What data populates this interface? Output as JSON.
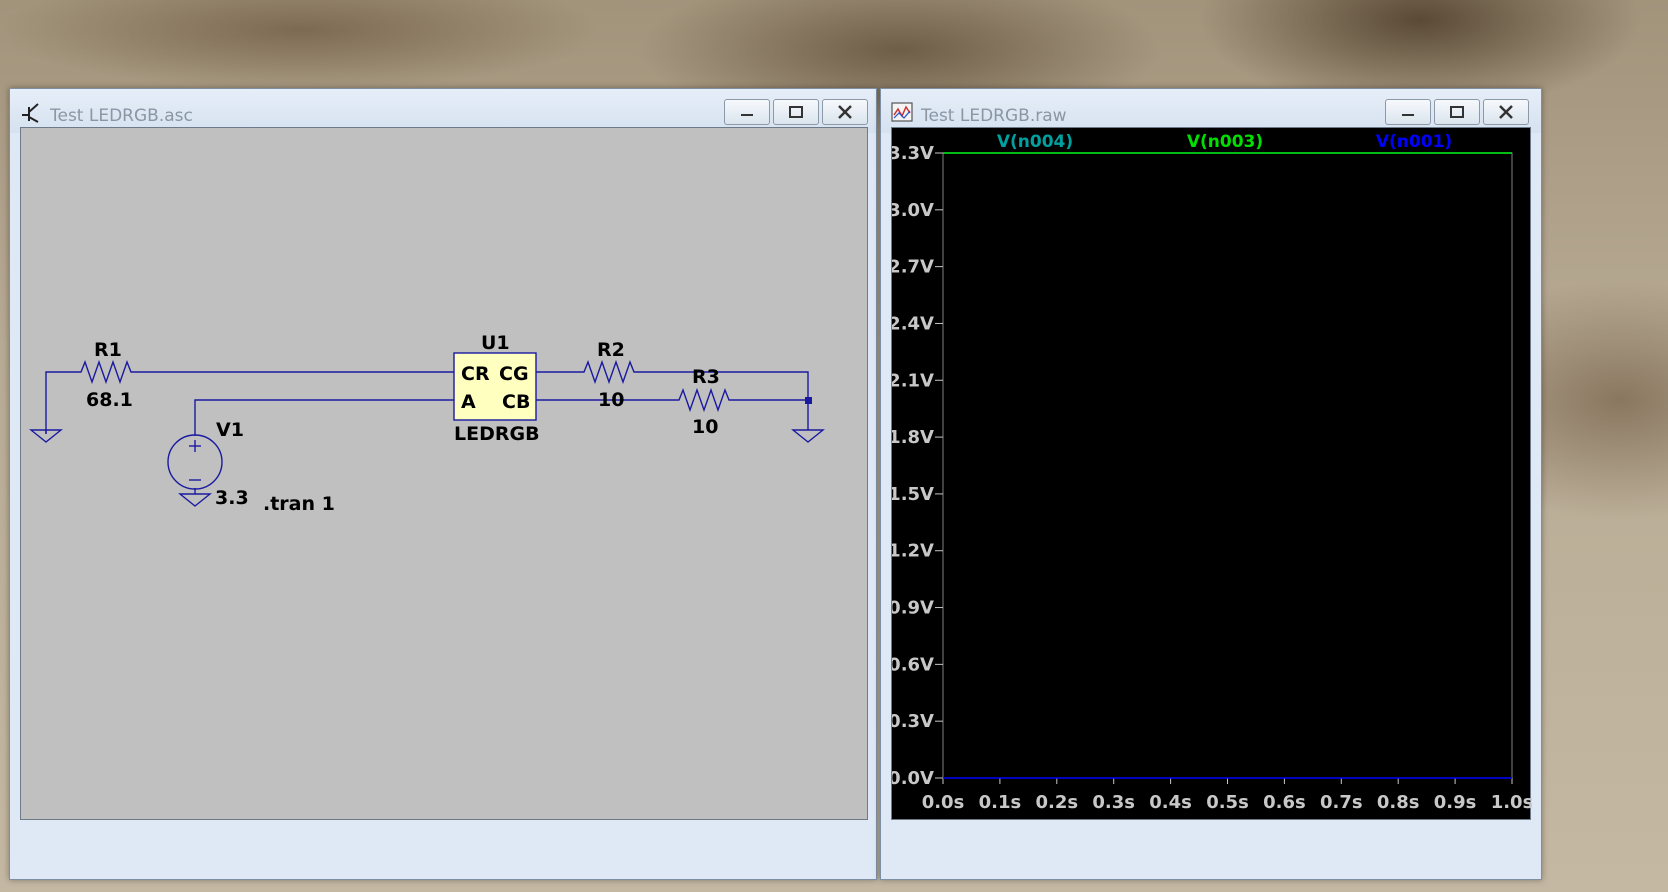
{
  "schematic_window": {
    "title": "Test LEDRGB.asc",
    "components": {
      "r1": {
        "name": "R1",
        "value": "68.1"
      },
      "r2": {
        "name": "R2",
        "value": "10"
      },
      "r3": {
        "name": "R3",
        "value": "10"
      },
      "v1": {
        "name": "V1",
        "value": "3.3"
      },
      "u1": {
        "name": "U1",
        "model": "LEDRGB",
        "pins": {
          "cr": "CR",
          "cg": "CG",
          "a": "A",
          "cb": "CB"
        }
      }
    },
    "directive": ".tran 1",
    "colors": {
      "background": "#c0c0c0",
      "wire": "#1a1aa0",
      "component_fill": "#ffffc0"
    }
  },
  "waveform_window": {
    "title": "Test LEDRGB.raw",
    "traces": [
      {
        "label": "V(n004)",
        "color": "#00a0a0"
      },
      {
        "label": "V(n003)",
        "color": "#00e000"
      },
      {
        "label": "V(n001)",
        "color": "#0000ff"
      }
    ]
  },
  "chart_data": {
    "type": "line",
    "title": "",
    "xlabel": "",
    "ylabel": "",
    "xlim": [
      0,
      1.0
    ],
    "ylim": [
      0,
      3.3
    ],
    "x_ticks": [
      "0.0s",
      "0.1s",
      "0.2s",
      "0.3s",
      "0.4s",
      "0.5s",
      "0.6s",
      "0.7s",
      "0.8s",
      "0.9s",
      "1.0s"
    ],
    "y_ticks": [
      "0.0V",
      "0.3V",
      "0.6V",
      "0.9V",
      "1.2V",
      "1.5V",
      "1.8V",
      "2.1V",
      "2.4V",
      "2.7V",
      "3.0V",
      "3.3V"
    ],
    "series": [
      {
        "name": "V(n004)",
        "color": "#00a0a0",
        "x": [
          0,
          1.0
        ],
        "y": [
          3.3,
          3.3
        ]
      },
      {
        "name": "V(n003)",
        "color": "#00e000",
        "x": [
          0,
          1.0
        ],
        "y": [
          3.3,
          3.3
        ]
      },
      {
        "name": "V(n001)",
        "color": "#0000ff",
        "x": [
          0,
          1.0
        ],
        "y": [
          0,
          0
        ]
      }
    ],
    "background": "#000000",
    "grid": false
  }
}
